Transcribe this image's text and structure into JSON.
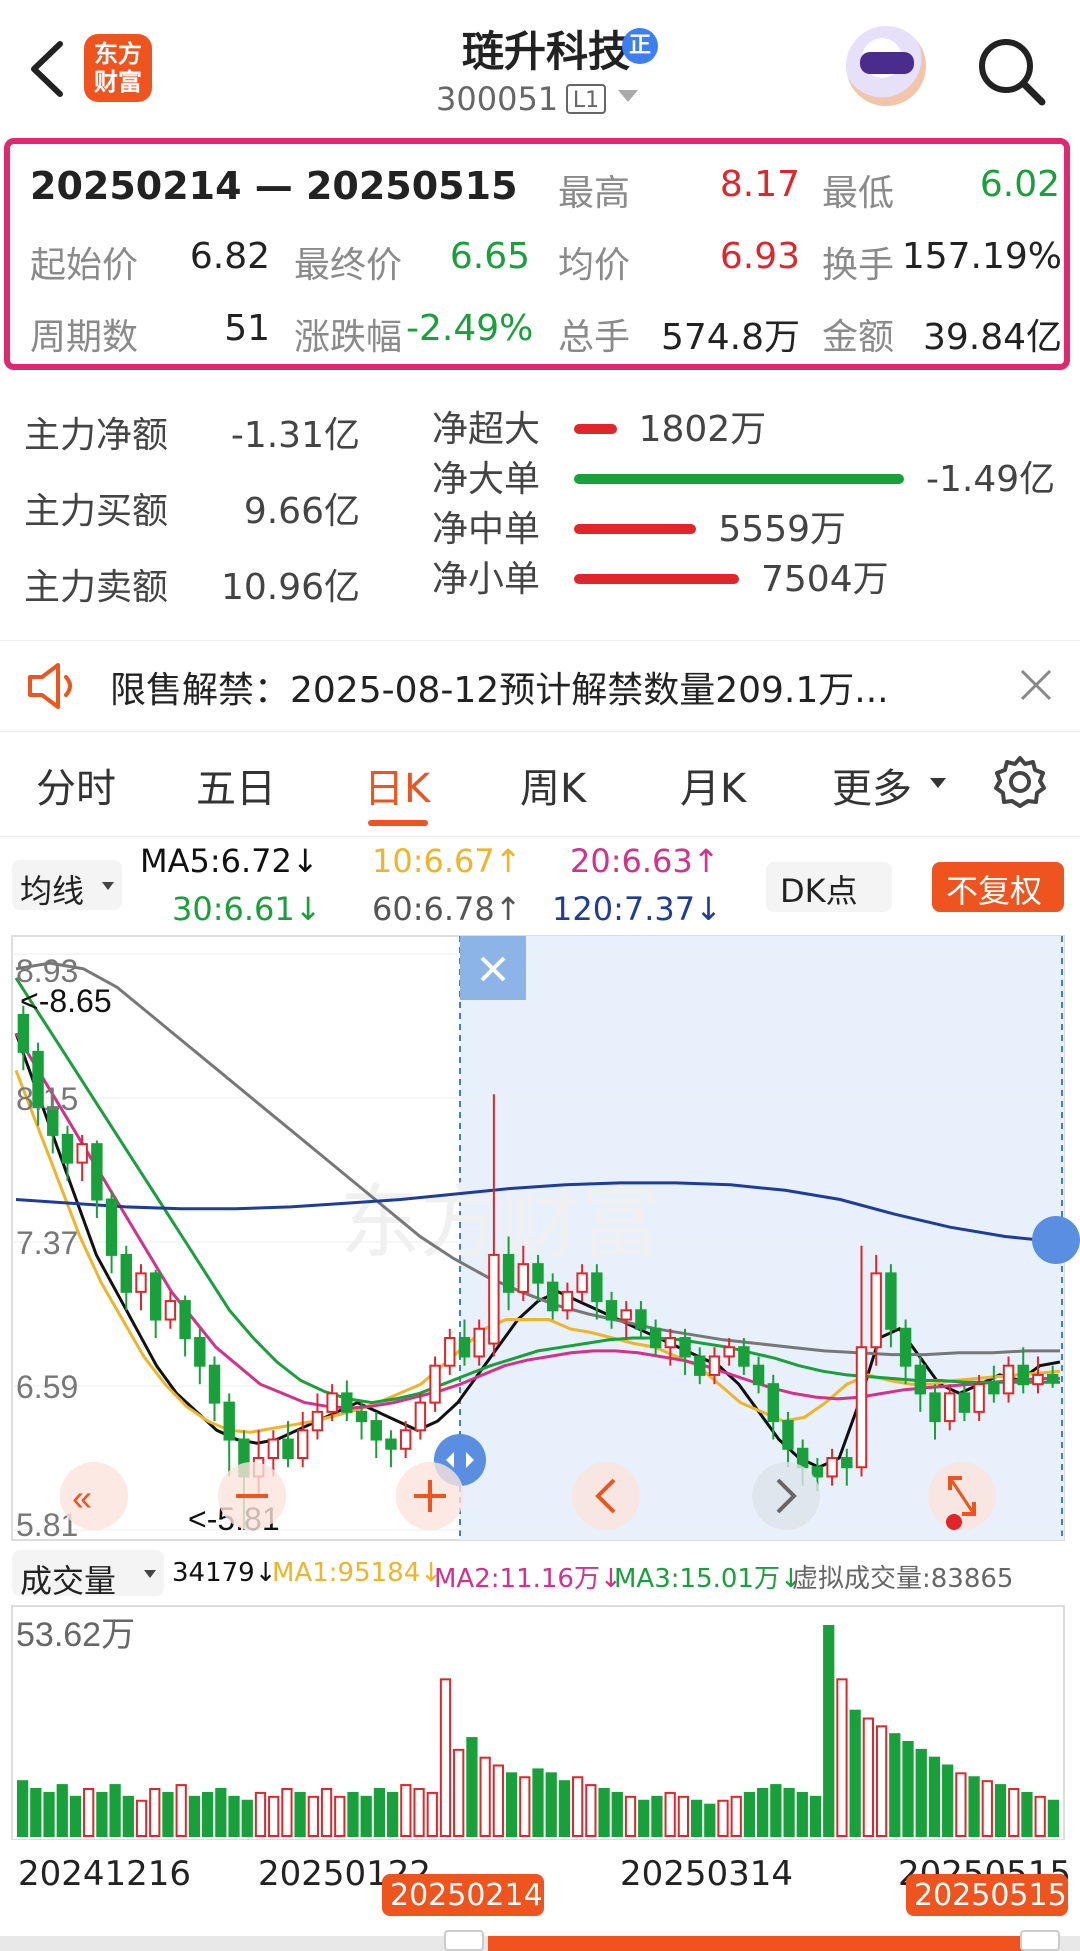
{
  "header": {
    "logo_text": "东方财富",
    "stock_name": "琏升科技",
    "badge": "正",
    "stock_code": "300051",
    "level": "L1"
  },
  "summary": {
    "range": "20250214 — 20250515",
    "high_label": "最高",
    "high": "8.17",
    "low_label": "最低",
    "low": "6.02",
    "start_label": "起始价",
    "start": "6.82",
    "end_label": "最终价",
    "end": "6.65",
    "avg_label": "均价",
    "avg": "6.93",
    "turnover_label": "换手",
    "turnover": "157.19%",
    "periods_label": "周期数",
    "periods": "51",
    "change_label": "涨跌幅",
    "change": "-2.49%",
    "volume_label": "总手",
    "volume": "574.8万",
    "amount_label": "金额",
    "amount": "39.84亿"
  },
  "capital_flow": {
    "net_label": "主力净额",
    "net": "-1.31亿",
    "buy_label": "主力买额",
    "buy": "9.66亿",
    "sell_label": "主力卖额",
    "sell": "10.96亿",
    "rows": [
      {
        "label": "净超大",
        "value": "1802万",
        "fraction": 0.08,
        "color": "#e0252b"
      },
      {
        "label": "净大单",
        "value": "-1.49亿",
        "fraction": 0.62,
        "color": "#18a03a"
      },
      {
        "label": "净中单",
        "value": "5559万",
        "fraction": 0.23,
        "color": "#e0252b"
      },
      {
        "label": "净小单",
        "value": "7504万",
        "fraction": 0.31,
        "color": "#e0252b"
      }
    ]
  },
  "notice": {
    "text": "限售解禁：2025-08-12预计解禁数量209.1万..."
  },
  "tabs": [
    "分时",
    "五日",
    "日K",
    "周K",
    "月K",
    "更多"
  ],
  "active_tab": "日K",
  "ma_bar": {
    "selector": "均线",
    "ma5": "MA5:6.72↓",
    "ma10": "10:6.67↑",
    "ma20": "20:6.63↑",
    "ma30": "30:6.61↓",
    "ma60": "60:6.78↑",
    "ma120": "120:7.37↓",
    "dk_button": "DK点",
    "adjust_button": "不复权"
  },
  "price_axis": [
    "8.93",
    "8.15",
    "7.37",
    "6.59",
    "5.81"
  ],
  "price_marks": {
    "high": "<-8.65",
    "low": "<-5.81"
  },
  "volume_bar": {
    "selector": "成交量",
    "vol": "34179↓",
    "ma1": "MA1:95184↓",
    "ma2": "MA2:11.16万↓",
    "ma3": "MA3:15.01万↓",
    "virtual": "虚拟成交量:83865"
  },
  "volume_axis_max": "53.62万",
  "date_axis": [
    "20241216",
    "20250122",
    "20250314",
    "20250515"
  ],
  "range_start_tag": "20250214",
  "range_end_tag": "20250515",
  "colors": {
    "up": "#e0252b",
    "down": "#18a03a",
    "accent": "#f0541e",
    "highlight": "#e0286e"
  },
  "chart_data": {
    "type": "candlestick",
    "title": "",
    "price_range": [
      5.81,
      8.93
    ],
    "candles": [
      {
        "o": 8.6,
        "c": 8.4,
        "h": 8.65,
        "l": 8.3
      },
      {
        "o": 8.4,
        "c": 8.1,
        "h": 8.45,
        "l": 8.0
      },
      {
        "o": 8.1,
        "c": 7.95,
        "h": 8.2,
        "l": 7.85
      },
      {
        "o": 7.95,
        "c": 7.8,
        "h": 8.0,
        "l": 7.7
      },
      {
        "o": 7.8,
        "c": 7.9,
        "h": 7.95,
        "l": 7.7
      },
      {
        "o": 7.9,
        "c": 7.6,
        "h": 7.92,
        "l": 7.5
      },
      {
        "o": 7.6,
        "c": 7.3,
        "h": 7.65,
        "l": 7.2
      },
      {
        "o": 7.3,
        "c": 7.1,
        "h": 7.35,
        "l": 7.0
      },
      {
        "o": 7.1,
        "c": 7.2,
        "h": 7.25,
        "l": 7.0
      },
      {
        "o": 7.2,
        "c": 6.95,
        "h": 7.22,
        "l": 6.85
      },
      {
        "o": 6.95,
        "c": 7.05,
        "h": 7.1,
        "l": 6.9
      },
      {
        "o": 7.05,
        "c": 6.85,
        "h": 7.08,
        "l": 6.75
      },
      {
        "o": 6.85,
        "c": 6.7,
        "h": 6.9,
        "l": 6.6
      },
      {
        "o": 6.7,
        "c": 6.5,
        "h": 6.75,
        "l": 6.4
      },
      {
        "o": 6.5,
        "c": 6.3,
        "h": 6.55,
        "l": 6.1
      },
      {
        "o": 6.3,
        "c": 6.1,
        "h": 6.35,
        "l": 5.81
      },
      {
        "o": 6.1,
        "c": 6.2,
        "h": 6.35,
        "l": 6.0
      },
      {
        "o": 6.2,
        "c": 6.3,
        "h": 6.35,
        "l": 6.1
      },
      {
        "o": 6.3,
        "c": 6.2,
        "h": 6.4,
        "l": 6.15
      },
      {
        "o": 6.2,
        "c": 6.35,
        "h": 6.45,
        "l": 6.15
      },
      {
        "o": 6.35,
        "c": 6.45,
        "h": 6.55,
        "l": 6.3
      },
      {
        "o": 6.45,
        "c": 6.55,
        "h": 6.6,
        "l": 6.4
      },
      {
        "o": 6.55,
        "c": 6.45,
        "h": 6.62,
        "l": 6.4
      },
      {
        "o": 6.45,
        "c": 6.4,
        "h": 6.5,
        "l": 6.3
      },
      {
        "o": 6.4,
        "c": 6.3,
        "h": 6.45,
        "l": 6.2
      },
      {
        "o": 6.3,
        "c": 6.25,
        "h": 6.35,
        "l": 6.15
      },
      {
        "o": 6.25,
        "c": 6.35,
        "h": 6.4,
        "l": 6.2
      },
      {
        "o": 6.35,
        "c": 6.5,
        "h": 6.55,
        "l": 6.3
      },
      {
        "o": 6.5,
        "c": 6.7,
        "h": 6.75,
        "l": 6.45
      },
      {
        "o": 6.7,
        "c": 6.85,
        "h": 6.9,
        "l": 6.65
      },
      {
        "o": 6.85,
        "c": 6.75,
        "h": 6.95,
        "l": 6.7
      },
      {
        "o": 6.75,
        "c": 6.9,
        "h": 6.95,
        "l": 6.7
      },
      {
        "o": 6.82,
        "c": 7.3,
        "h": 8.17,
        "l": 6.75
      },
      {
        "o": 7.3,
        "c": 7.1,
        "h": 7.4,
        "l": 7.0
      },
      {
        "o": 7.1,
        "c": 7.25,
        "h": 7.35,
        "l": 7.05
      },
      {
        "o": 7.25,
        "c": 7.15,
        "h": 7.3,
        "l": 7.05
      },
      {
        "o": 7.15,
        "c": 7.0,
        "h": 7.2,
        "l": 6.95
      },
      {
        "o": 7.0,
        "c": 7.1,
        "h": 7.15,
        "l": 6.95
      },
      {
        "o": 7.1,
        "c": 7.2,
        "h": 7.25,
        "l": 7.05
      },
      {
        "o": 7.2,
        "c": 7.05,
        "h": 7.25,
        "l": 6.95
      },
      {
        "o": 7.05,
        "c": 6.95,
        "h": 7.1,
        "l": 6.9
      },
      {
        "o": 6.95,
        "c": 7.0,
        "h": 7.05,
        "l": 6.85
      },
      {
        "o": 7.0,
        "c": 6.9,
        "h": 7.05,
        "l": 6.85
      },
      {
        "o": 6.9,
        "c": 6.8,
        "h": 6.95,
        "l": 6.75
      },
      {
        "o": 6.8,
        "c": 6.85,
        "h": 6.9,
        "l": 6.7
      },
      {
        "o": 6.85,
        "c": 6.75,
        "h": 6.9,
        "l": 6.65
      },
      {
        "o": 6.75,
        "c": 6.65,
        "h": 6.8,
        "l": 6.6
      },
      {
        "o": 6.65,
        "c": 6.75,
        "h": 6.8,
        "l": 6.6
      },
      {
        "o": 6.75,
        "c": 6.8,
        "h": 6.85,
        "l": 6.7
      },
      {
        "o": 6.8,
        "c": 6.7,
        "h": 6.85,
        "l": 6.65
      },
      {
        "o": 6.7,
        "c": 6.6,
        "h": 6.75,
        "l": 6.55
      },
      {
        "o": 6.6,
        "c": 6.4,
        "h": 6.65,
        "l": 6.3
      },
      {
        "o": 6.4,
        "c": 6.25,
        "h": 6.45,
        "l": 6.15
      },
      {
        "o": 6.25,
        "c": 6.15,
        "h": 6.3,
        "l": 6.05
      },
      {
        "o": 6.15,
        "c": 6.1,
        "h": 6.2,
        "l": 6.02
      },
      {
        "o": 6.1,
        "c": 6.2,
        "h": 6.25,
        "l": 6.05
      },
      {
        "o": 6.2,
        "c": 6.15,
        "h": 6.25,
        "l": 6.05
      },
      {
        "o": 6.15,
        "c": 6.8,
        "h": 7.35,
        "l": 6.1
      },
      {
        "o": 6.8,
        "c": 7.2,
        "h": 7.3,
        "l": 6.7
      },
      {
        "o": 7.2,
        "c": 6.9,
        "h": 7.25,
        "l": 6.8
      },
      {
        "o": 6.9,
        "c": 6.7,
        "h": 6.95,
        "l": 6.6
      },
      {
        "o": 6.7,
        "c": 6.55,
        "h": 6.75,
        "l": 6.45
      },
      {
        "o": 6.55,
        "c": 6.4,
        "h": 6.6,
        "l": 6.3
      },
      {
        "o": 6.4,
        "c": 6.55,
        "h": 6.6,
        "l": 6.35
      },
      {
        "o": 6.55,
        "c": 6.45,
        "h": 6.6,
        "l": 6.4
      },
      {
        "o": 6.45,
        "c": 6.6,
        "h": 6.65,
        "l": 6.4
      },
      {
        "o": 6.6,
        "c": 6.55,
        "h": 6.7,
        "l": 6.5
      },
      {
        "o": 6.55,
        "c": 6.7,
        "h": 6.75,
        "l": 6.5
      },
      {
        "o": 6.7,
        "c": 6.6,
        "h": 6.8,
        "l": 6.55
      },
      {
        "o": 6.6,
        "c": 6.65,
        "h": 6.75,
        "l": 6.55
      },
      {
        "o": 6.65,
        "c": 6.62,
        "h": 6.7,
        "l": 6.58
      }
    ],
    "ma_lines": [
      {
        "name": "MA5",
        "color": "#111111",
        "values": [
          8.5,
          8.2,
          7.9,
          7.6,
          7.3,
          7.1,
          6.9,
          6.7,
          6.55,
          6.45,
          6.35,
          6.3,
          6.28,
          6.3,
          6.35,
          6.4,
          6.45,
          6.5,
          6.45,
          6.4,
          6.35,
          6.4,
          6.5,
          6.65,
          6.8,
          6.95,
          7.05,
          7.1,
          7.05,
          7.0,
          6.95,
          6.9,
          6.85,
          6.8,
          6.75,
          6.7,
          6.6,
          6.45,
          6.3,
          6.2,
          6.15,
          6.2,
          6.5,
          6.85,
          6.9,
          6.75,
          6.6,
          6.55,
          6.6,
          6.65,
          6.62,
          6.7,
          6.72
        ]
      },
      {
        "name": "MA10",
        "color": "#f0b428",
        "values": [
          8.3,
          8.0,
          7.7,
          7.4,
          7.15,
          6.95,
          6.75,
          6.6,
          6.48,
          6.4,
          6.35,
          6.34,
          6.36,
          6.38,
          6.4,
          6.43,
          6.46,
          6.5,
          6.55,
          6.6,
          6.7,
          6.8,
          6.9,
          6.95,
          6.95,
          6.95,
          6.9,
          6.88,
          6.85,
          6.82,
          6.8,
          6.75,
          6.7,
          6.6,
          6.5,
          6.45,
          6.4,
          6.42,
          6.5,
          6.6,
          6.65,
          6.62,
          6.6,
          6.6,
          6.62,
          6.63,
          6.64,
          6.65,
          6.66,
          6.67
        ]
      },
      {
        "name": "MA20",
        "color": "#d4308c",
        "values": [
          8.5,
          8.3,
          8.1,
          7.9,
          7.7,
          7.5,
          7.3,
          7.1,
          6.95,
          6.8,
          6.7,
          6.6,
          6.55,
          6.5,
          6.48,
          6.47,
          6.48,
          6.5,
          6.53,
          6.56,
          6.6,
          6.65,
          6.7,
          6.73,
          6.75,
          6.77,
          6.78,
          6.78,
          6.77,
          6.75,
          6.73,
          6.7,
          6.66,
          6.62,
          6.58,
          6.55,
          6.53,
          6.52,
          6.53,
          6.55,
          6.57,
          6.58,
          6.59,
          6.6,
          6.61,
          6.62,
          6.63,
          6.63
        ]
      },
      {
        "name": "MA30",
        "color": "#18a03a",
        "values": [
          8.8,
          8.6,
          8.4,
          8.2,
          8.0,
          7.8,
          7.6,
          7.4,
          7.2,
          7.0,
          6.85,
          6.72,
          6.62,
          6.56,
          6.52,
          6.5,
          6.52,
          6.55,
          6.6,
          6.65,
          6.7,
          6.74,
          6.78,
          6.8,
          6.82,
          6.84,
          6.85,
          6.85,
          6.84,
          6.82,
          6.8,
          6.77,
          6.74,
          6.7,
          6.67,
          6.65,
          6.64,
          6.63,
          6.62,
          6.62,
          6.61,
          6.61,
          6.61,
          6.61,
          6.61
        ]
      },
      {
        "name": "MA60",
        "color": "#777777",
        "values": [
          8.85,
          8.88,
          8.85,
          8.75,
          8.6,
          8.45,
          8.3,
          8.15,
          8.0,
          7.85,
          7.7,
          7.55,
          7.4,
          7.28,
          7.18,
          7.1,
          7.03,
          6.98,
          6.94,
          6.9,
          6.87,
          6.84,
          6.82,
          6.8,
          6.78,
          6.77,
          6.76,
          6.76,
          6.77,
          6.77,
          6.78,
          6.78
        ]
      },
      {
        "name": "MA120",
        "color": "#1e3c9c",
        "values": [
          7.6,
          7.58,
          7.56,
          7.55,
          7.55,
          7.56,
          7.58,
          7.6,
          7.63,
          7.66,
          7.68,
          7.69,
          7.69,
          7.68,
          7.65,
          7.6,
          7.52,
          7.45,
          7.4,
          7.37
        ]
      }
    ],
    "volume": [
      14,
      12,
      11,
      13,
      10,
      12,
      11,
      13,
      10,
      9,
      12,
      11,
      13,
      10,
      11,
      12,
      10,
      9,
      11,
      10,
      12,
      11,
      10,
      12,
      10,
      11,
      10,
      12,
      11,
      13,
      12,
      11,
      40,
      22,
      25,
      20,
      18,
      16,
      15,
      17,
      16,
      14,
      15,
      13,
      12,
      11,
      10,
      9,
      10,
      11,
      10,
      9,
      8,
      9,
      10,
      11,
      12,
      13,
      12,
      11,
      10,
      53.62,
      40,
      32,
      30,
      28,
      26,
      24,
      22,
      20,
      18,
      16,
      15,
      14,
      13,
      12,
      11,
      10,
      9
    ]
  }
}
